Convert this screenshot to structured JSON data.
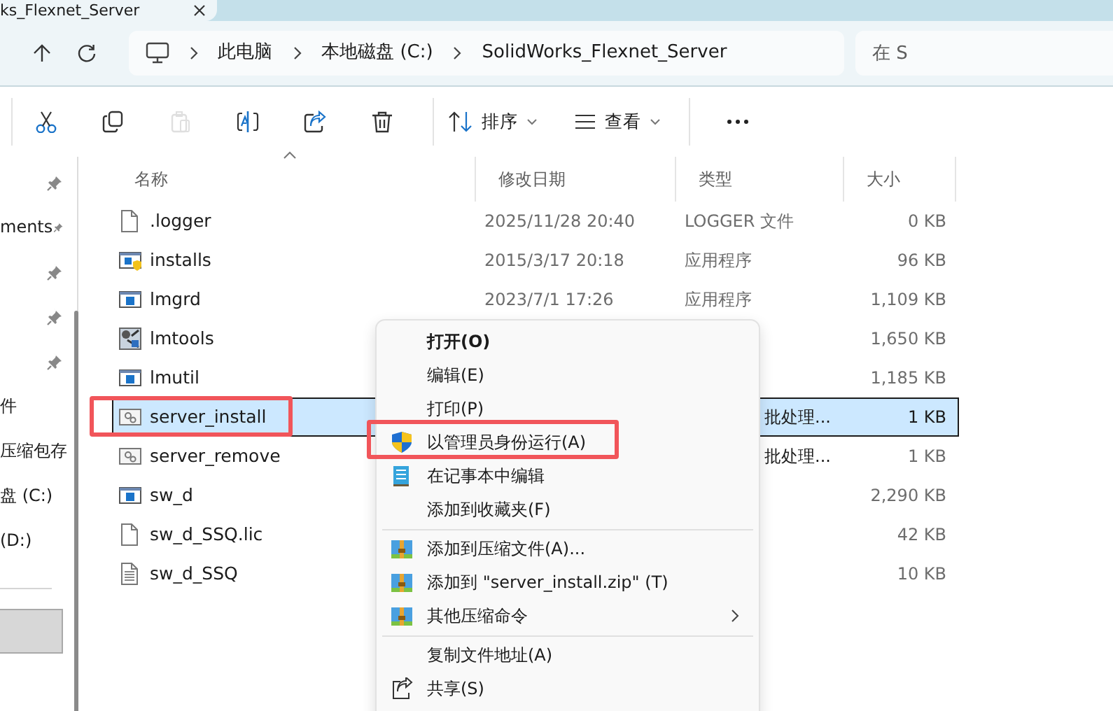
{
  "tab": {
    "title": "ks_Flexnet_Server"
  },
  "address": {
    "crumbs": [
      "此电脑",
      "本地磁盘 (C:)",
      "SolidWorks_Flexnet_Server"
    ],
    "search_placeholder": "在 S"
  },
  "toolbar": {
    "buttons": [
      {
        "kind": "cut",
        "disabled": false
      },
      {
        "kind": "copy",
        "disabled": false
      },
      {
        "kind": "paste",
        "disabled": true
      },
      {
        "kind": "rename",
        "disabled": false
      },
      {
        "kind": "share",
        "disabled": false
      },
      {
        "kind": "delete",
        "disabled": false
      }
    ],
    "sort": "排序",
    "view": "查看"
  },
  "sidebar": {
    "items": [
      {
        "pinned": true
      },
      {
        "label": "ments",
        "pinned": true
      },
      {
        "pinned": true
      },
      {
        "pinned": true
      },
      {
        "pinned": true
      },
      {
        "label": "件",
        "pinned": false
      },
      {
        "label": "压缩包存",
        "pinned": false
      },
      {
        "label": "盘 (C:)",
        "pinned": false
      },
      {
        "label": "(D:)",
        "pinned": false
      }
    ]
  },
  "file_list": {
    "columns": [
      "名称",
      "修改日期",
      "类型",
      "大小"
    ],
    "rows": [
      {
        "name": ".logger",
        "kind": "file",
        "date": "2025/11/28 20:40",
        "type": "LOGGER 文件",
        "size": "0 KB",
        "selected": false
      },
      {
        "name": "installs",
        "kind": "setup",
        "date": "2015/3/17 20:18",
        "type": "应用程序",
        "size": "96 KB",
        "selected": false
      },
      {
        "name": "lmgrd",
        "kind": "app",
        "date": "2023/7/1 17:26",
        "type": "应用程序",
        "size": "1,109 KB",
        "selected": false
      },
      {
        "name": "lmtools",
        "kind": "tool",
        "size": "1,650 KB",
        "selected": false
      },
      {
        "name": "lmutil",
        "kind": "app",
        "size": "1,185 KB",
        "selected": false
      },
      {
        "name": "server_install",
        "kind": "batch",
        "type": "批处理...",
        "size": "1 KB",
        "selected": true
      },
      {
        "name": "server_remove",
        "kind": "batch",
        "type": "批处理...",
        "size": "1 KB",
        "selected": false
      },
      {
        "name": "sw_d",
        "kind": "app",
        "size": "2,290 KB",
        "selected": false
      },
      {
        "name": "sw_d_SSQ.lic",
        "kind": "file",
        "size": "42 KB",
        "selected": false
      },
      {
        "name": "sw_d_SSQ",
        "kind": "text",
        "size": "10 KB",
        "selected": false
      }
    ]
  },
  "context_menu": {
    "items": [
      {
        "kind": "plain",
        "label": "打开(O)",
        "bold": true
      },
      {
        "kind": "plain",
        "label": "编辑(E)",
        "bold": false
      },
      {
        "kind": "plain",
        "label": "打印(P)",
        "bold": false
      },
      {
        "kind": "shield",
        "label": "以管理员身份运行(A)",
        "bold": false
      },
      {
        "kind": "notepad",
        "label": "在记事本中编辑",
        "bold": false
      },
      {
        "kind": "plain",
        "label": "添加到收藏夹(F)",
        "bold": false
      },
      {
        "kind": "separator"
      },
      {
        "kind": "archive",
        "label": "添加到压缩文件(A)...",
        "bold": false
      },
      {
        "kind": "archive",
        "label": "添加到 \"server_install.zip\" (T)",
        "bold": false
      },
      {
        "kind": "archive",
        "label": "其他压缩命令",
        "bold": false,
        "submenu": true
      },
      {
        "kind": "separator"
      },
      {
        "kind": "plain",
        "label": "复制文件地址(A)",
        "bold": false
      },
      {
        "kind": "share",
        "label": "共享(S)",
        "bold": false
      }
    ]
  }
}
